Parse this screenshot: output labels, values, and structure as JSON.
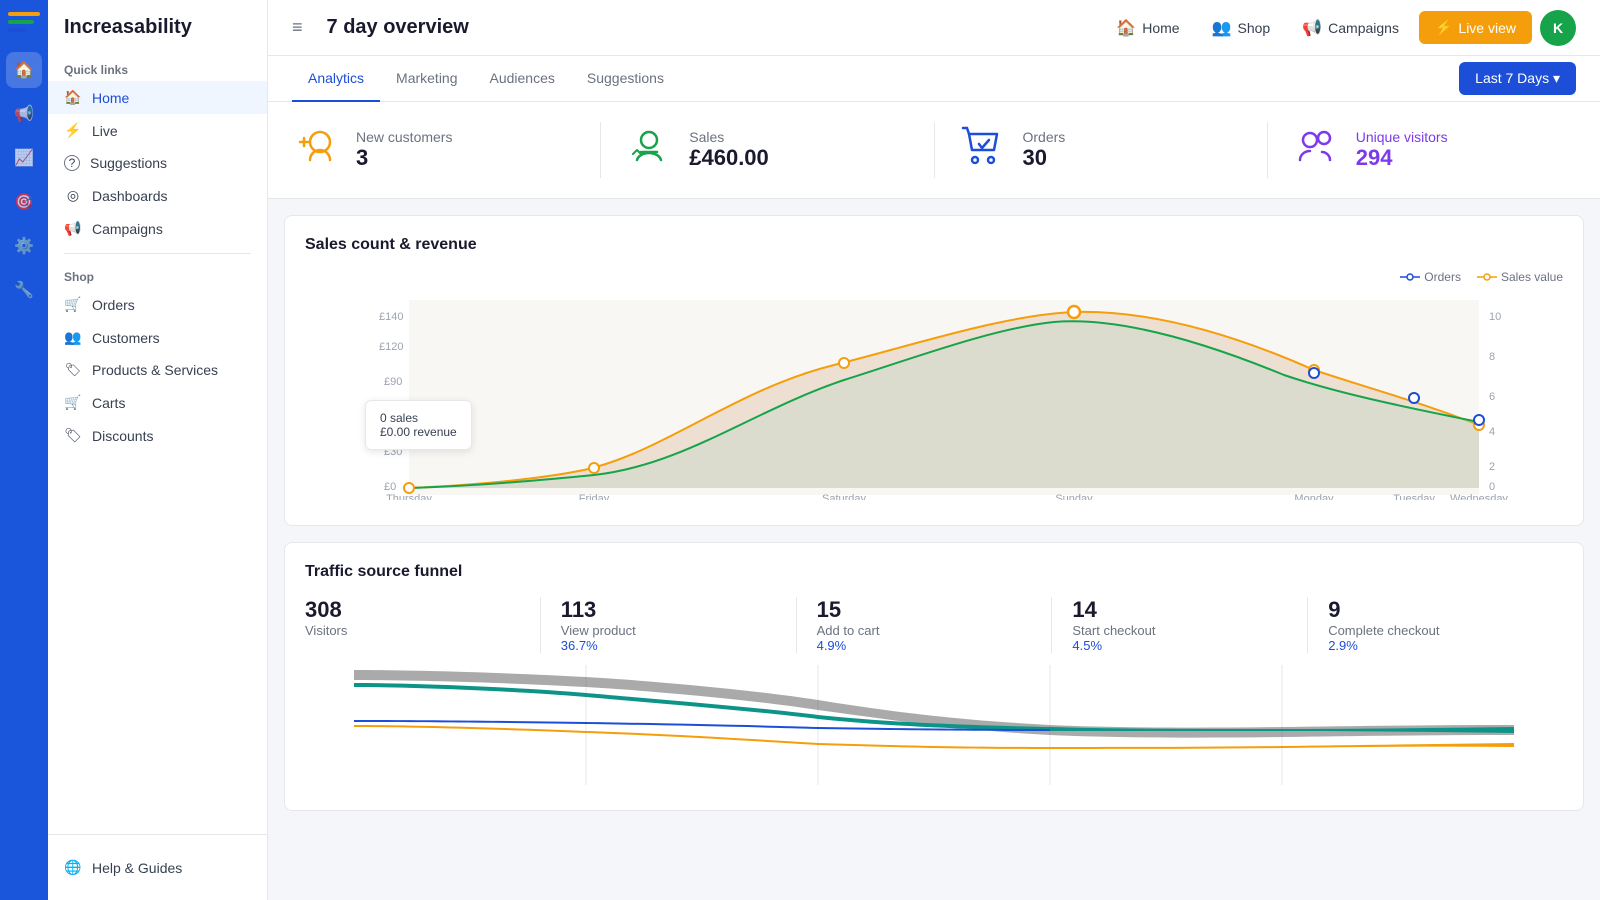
{
  "brand": {
    "name": "Increasability",
    "logo_initial": "K"
  },
  "topbar": {
    "title": "7 day overview",
    "nav_items": [
      {
        "label": "Home",
        "icon": "🏠"
      },
      {
        "label": "Shop",
        "icon": "👥"
      },
      {
        "label": "Campaigns",
        "icon": "📢"
      }
    ],
    "live_button": "Live view",
    "avatar": "K"
  },
  "tabs": {
    "items": [
      "Analytics",
      "Marketing",
      "Audiences",
      "Suggestions"
    ],
    "active": 0,
    "date_button": "Last 7 Days ▾"
  },
  "stats": [
    {
      "label": "New customers",
      "value": "3",
      "icon_color": "#f59e0b"
    },
    {
      "label": "Sales",
      "value": "£460.00",
      "icon_color": "#16a34a"
    },
    {
      "label": "Orders",
      "value": "30",
      "icon_color": "#1d4ed8"
    },
    {
      "label": "Unique visitors",
      "value": "294",
      "icon_color": "#7c3aed"
    }
  ],
  "sales_chart": {
    "title": "Sales count & revenue",
    "legend": [
      {
        "label": "Orders",
        "color": "#1d4ed8"
      },
      {
        "label": "Sales value",
        "color": "#f59e0b"
      }
    ],
    "tooltip": {
      "line1": "0 sales",
      "line2": "£0.00 revenue"
    },
    "x_labels": [
      "Thursday",
      "Friday",
      "Saturday",
      "Sunday",
      "Monday",
      "Tuesday",
      "Wednesday"
    ],
    "y_labels": [
      "£0",
      "£30",
      "£60",
      "£90",
      "£120",
      "£140"
    ]
  },
  "funnel": {
    "title": "Traffic source funnel",
    "steps": [
      {
        "num": "308",
        "label": "Visitors",
        "pct": null
      },
      {
        "num": "113",
        "label": "View product",
        "pct": "36.7%"
      },
      {
        "num": "15",
        "label": "Add to cart",
        "pct": "4.9%"
      },
      {
        "num": "14",
        "label": "Start checkout",
        "pct": "4.5%"
      },
      {
        "num": "9",
        "label": "Complete checkout",
        "pct": "2.9%"
      }
    ]
  },
  "sidebar": {
    "quick_links_title": "Quick links",
    "quick_links": [
      {
        "label": "Home",
        "icon": "🏠",
        "active": true
      },
      {
        "label": "Live",
        "icon": "⚡"
      },
      {
        "label": "Suggestions",
        "icon": "?"
      },
      {
        "label": "Dashboards",
        "icon": "◎"
      },
      {
        "label": "Campaigns",
        "icon": "📢"
      }
    ],
    "shop_title": "Shop",
    "shop_items": [
      {
        "label": "Orders",
        "icon": "🛒"
      },
      {
        "label": "Customers",
        "icon": "👥"
      },
      {
        "label": "Products & Services",
        "icon": "🏷"
      },
      {
        "label": "Carts",
        "icon": "🛒"
      },
      {
        "label": "Discounts",
        "icon": "🏷"
      }
    ],
    "bottom": {
      "label": "Help & Guides",
      "icon": "🌐"
    }
  }
}
